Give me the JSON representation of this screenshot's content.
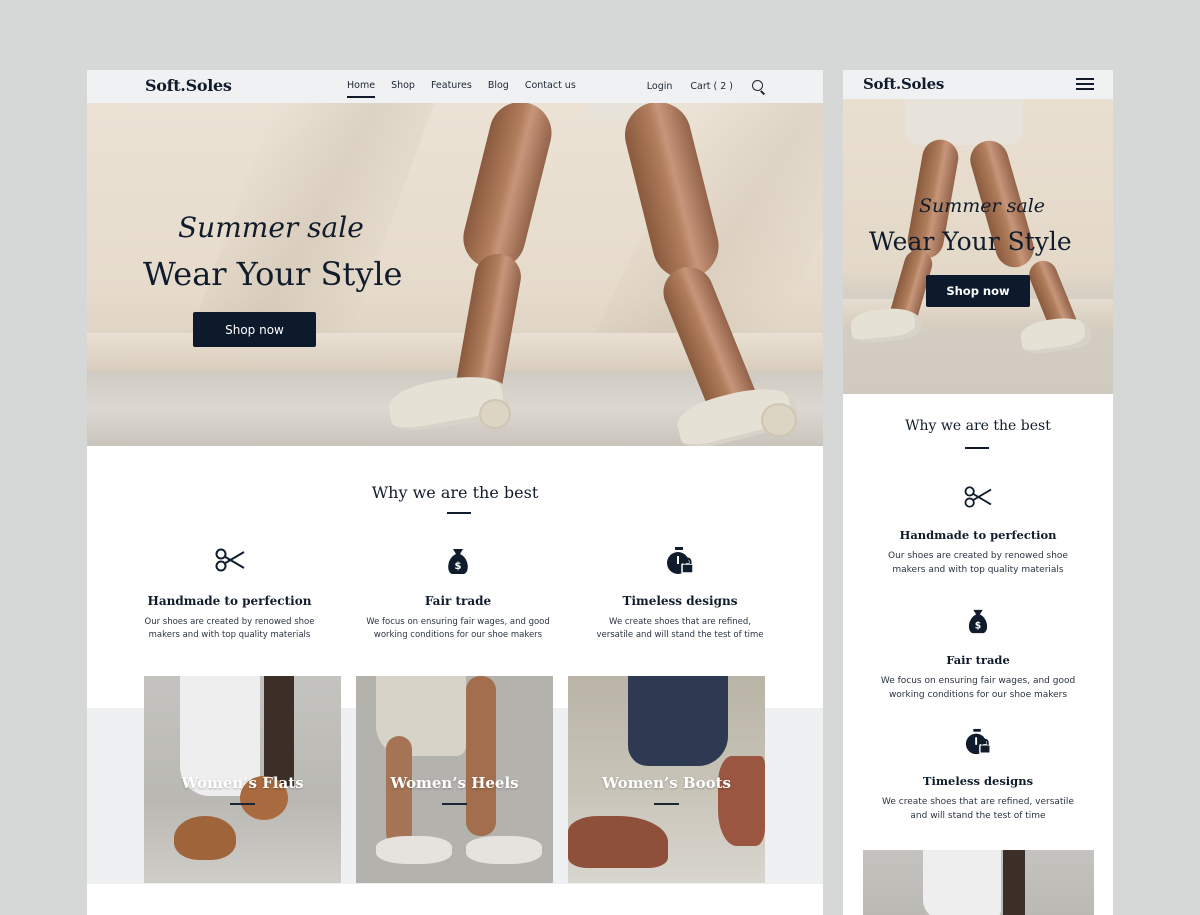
{
  "brand": "Soft.Soles",
  "nav": {
    "links": [
      "Home",
      "Shop",
      "Features",
      "Blog",
      "Contact us"
    ],
    "active": "Home",
    "login": "Login",
    "cart": "Cart ( 2 )"
  },
  "hero": {
    "script": "Summer sale",
    "title": "Wear Your Style",
    "cta": "Shop now"
  },
  "why": {
    "title": "Why we are the best",
    "features": [
      {
        "icon": "scissors-icon",
        "title": "Handmade to perfection",
        "desc_desktop": [
          "Our shoes are created by renowed shoe",
          "makers and with top quality materials"
        ],
        "desc_mobile": [
          "Our shoes are created by renowed shoe",
          "makers and with top quality materials"
        ]
      },
      {
        "icon": "money-bag-icon",
        "title": "Fair trade",
        "desc_desktop": [
          "We focus on ensuring fair wages, and good",
          "working conditions for our shoe makers"
        ],
        "desc_mobile": [
          "We focus on ensuring fair wages, and good",
          "working conditions for our shoe makers"
        ]
      },
      {
        "icon": "stopwatch-lock-icon",
        "title": "Timeless designs",
        "desc_desktop": [
          "We create shoes that are refined,",
          "versatile and will stand the test of time"
        ],
        "desc_mobile": [
          "We create shoes that are refined, versatile",
          "and will stand the test of time"
        ]
      }
    ]
  },
  "categories": [
    {
      "label": "Women’s Flats"
    },
    {
      "label": "Women’s Heels"
    },
    {
      "label": "Women’s Boots"
    }
  ],
  "colors": {
    "navy": "#0c1a2b",
    "nav_bg": "#f0f1f2",
    "page_bg": "#d6d8d7",
    "band_bg": "#eef0f1"
  }
}
